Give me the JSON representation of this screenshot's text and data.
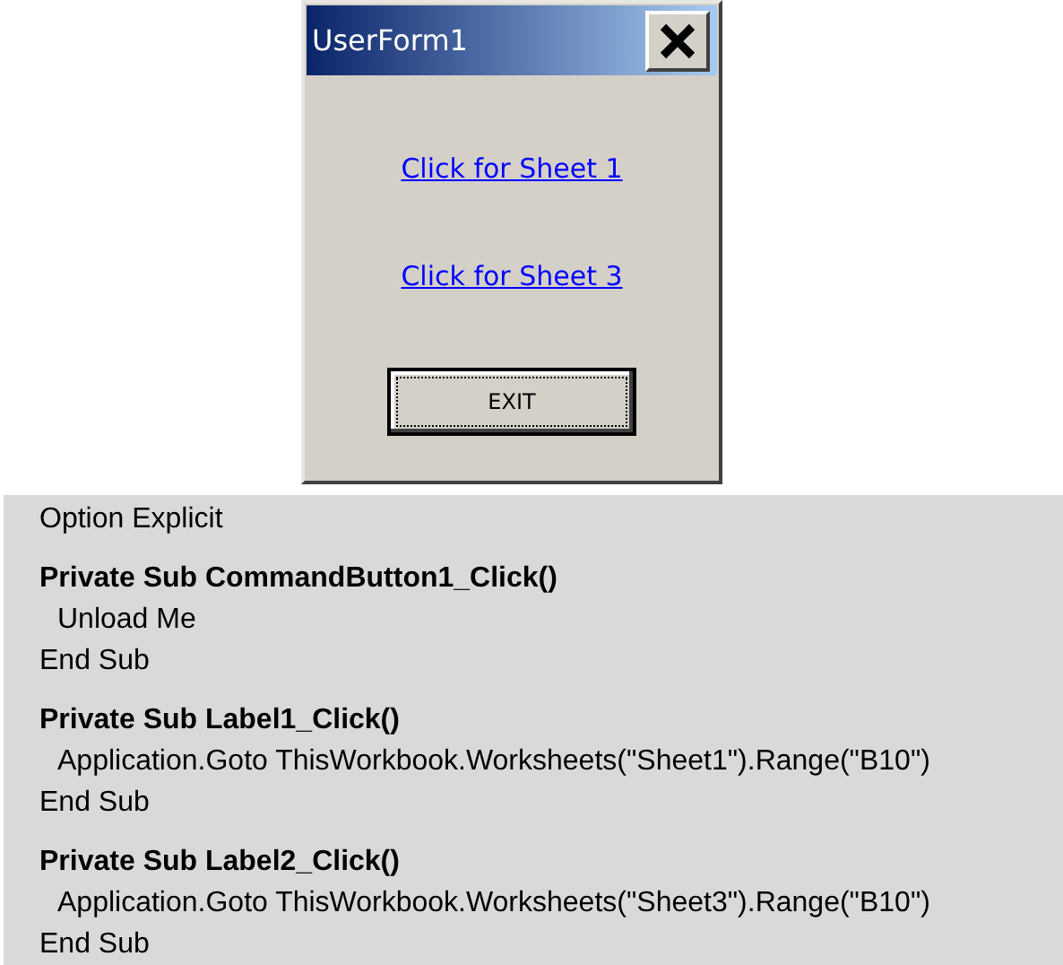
{
  "window": {
    "title": "UserForm1"
  },
  "links": [
    {
      "label": "Click for Sheet 1"
    },
    {
      "label": "Click for Sheet 3"
    }
  ],
  "exit_button": {
    "label": "EXIT",
    "focused": true
  },
  "code": [
    [
      {
        "kind": "plain",
        "text": "Option Explicit"
      }
    ],
    [
      {
        "kind": "header",
        "text": "Private Sub CommandButton1_Click()"
      },
      {
        "kind": "body",
        "text": "Unload Me"
      },
      {
        "kind": "plain",
        "text": "End Sub"
      }
    ],
    [
      {
        "kind": "header",
        "text": "Private Sub Label1_Click()"
      },
      {
        "kind": "body",
        "text": "Application.Goto ThisWorkbook.Worksheets(\"Sheet1\").Range(\"B10\")"
      },
      {
        "kind": "plain",
        "text": "End Sub"
      }
    ],
    [
      {
        "kind": "header",
        "text": "Private Sub Label2_Click()"
      },
      {
        "kind": "body",
        "text": "Application.Goto ThisWorkbook.Worksheets(\"Sheet3\").Range(\"B10\")"
      },
      {
        "kind": "plain",
        "text": "End Sub"
      }
    ]
  ]
}
